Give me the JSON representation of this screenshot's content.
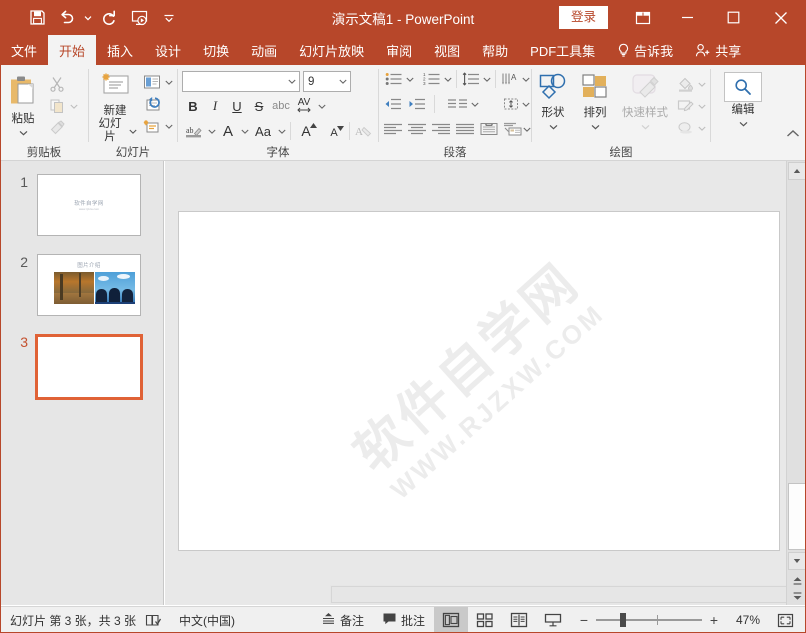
{
  "titlebar": {
    "document_title": "演示文稿1",
    "separator": "-",
    "app_name": "PowerPoint",
    "signin_label": "登录",
    "quick_access": [
      {
        "name": "save-icon",
        "label": "保存"
      },
      {
        "name": "undo-icon",
        "label": "撤消"
      },
      {
        "name": "redo-icon",
        "label": "恢复"
      },
      {
        "name": "start-slideshow-icon",
        "label": "从头开始"
      },
      {
        "name": "customize-quick-access-icon",
        "label": "自定义快速访问工具栏"
      }
    ],
    "window_buttons": [
      {
        "name": "ribbon-display-options-icon",
        "label": "功能区显示选项"
      },
      {
        "name": "minimize-icon",
        "label": "最小化"
      },
      {
        "name": "maximize-icon",
        "label": "最大化"
      },
      {
        "name": "close-icon",
        "label": "关闭"
      }
    ]
  },
  "tabs": [
    {
      "id": "file",
      "label": "文件",
      "active": false
    },
    {
      "id": "home",
      "label": "开始",
      "active": true
    },
    {
      "id": "insert",
      "label": "插入",
      "active": false
    },
    {
      "id": "design",
      "label": "设计",
      "active": false
    },
    {
      "id": "transitions",
      "label": "切换",
      "active": false
    },
    {
      "id": "animations",
      "label": "动画",
      "active": false
    },
    {
      "id": "slideshow",
      "label": "幻灯片放映",
      "active": false
    },
    {
      "id": "review",
      "label": "审阅",
      "active": false
    },
    {
      "id": "view",
      "label": "视图",
      "active": false
    },
    {
      "id": "help",
      "label": "帮助",
      "active": false
    },
    {
      "id": "pdf-toolkit",
      "label": "PDF工具集",
      "active": false
    }
  ],
  "tell_me": {
    "label": "告诉我",
    "icon": "lightbulb-icon"
  },
  "share": {
    "label": "共享",
    "icon": "person-add-icon"
  },
  "ribbon": {
    "clipboard": {
      "label": "剪贴板",
      "paste_label": "粘贴",
      "cut_label": "剪切",
      "copy_label": "复制",
      "format_painter_label": "格式刷"
    },
    "slides": {
      "label": "幻灯片",
      "new_slide_label": "新建\n幻灯片",
      "new_slide_line1": "新建",
      "new_slide_line2": "幻灯片",
      "layout_label": "版式",
      "reset_label": "重置",
      "section_label": "节"
    },
    "font": {
      "label": "字体",
      "font_name_value": "",
      "font_name_placeholder": "",
      "font_size_value": "9",
      "bold": "B",
      "italic": "I",
      "underline": "U",
      "strikethrough": "S",
      "shadow": "abc",
      "char_spacing": "AV",
      "text_highlight": "ab",
      "font_color": "A",
      "change_case": "Aa",
      "grow_font": "A",
      "shrink_font": "A",
      "clear_formatting": "清除所有格式"
    },
    "paragraph": {
      "label": "段落",
      "bullets": "项目符号",
      "numbering": "编号",
      "line_spacing": "行距",
      "text_direction": "文字方向",
      "decrease_indent": "减少缩进量",
      "increase_indent": "增加缩进量",
      "columns": "分栏",
      "align_text": "对齐文本",
      "align_left": "左对齐",
      "align_center": "居中",
      "align_right": "右对齐",
      "justify": "两端对齐",
      "convert_smartart": "转换为 SmartArt"
    },
    "drawing": {
      "label": "绘图",
      "shapes_label": "形状",
      "arrange_label": "排列",
      "quick_styles_label": "快速样式",
      "shape_fill": "形状填充",
      "shape_outline": "形状轮廓",
      "shape_effects": "形状效果"
    },
    "editing": {
      "label": "编辑",
      "edit_label": "编辑"
    },
    "collapse_ribbon": "折叠功能区"
  },
  "slides_panel": {
    "slides": [
      {
        "number": "1",
        "selected": false,
        "title": "软件自学网",
        "subtitle": "www.rjzxw.com",
        "kind": "title"
      },
      {
        "number": "2",
        "selected": false,
        "title": "图片介绍",
        "kind": "two-images"
      },
      {
        "number": "3",
        "selected": true,
        "title": "",
        "kind": "blank"
      }
    ]
  },
  "canvas": {
    "watermark_cn": "软件自学网",
    "watermark_en": "WWW.RJZXW.COM"
  },
  "statusbar": {
    "slide_count_text": "幻灯片 第 3 张，共 3 张",
    "spellcheck_icon": "proofing-icon",
    "language": "中文(中国)",
    "notes_label": "备注",
    "comments_label": "批注",
    "views": [
      {
        "id": "normal",
        "label": "普通视图",
        "icon": "normal-view-icon",
        "active": true
      },
      {
        "id": "sorter",
        "label": "幻灯片浏览",
        "icon": "slide-sorter-icon",
        "active": false
      },
      {
        "id": "reading",
        "label": "阅读视图",
        "icon": "reading-view-icon",
        "active": false
      },
      {
        "id": "slideshow",
        "label": "幻灯片放映",
        "icon": "slideshow-view-icon",
        "active": false
      }
    ],
    "zoom_out": "−",
    "zoom_in": "+",
    "zoom_value": "47%",
    "fit_window_label": "使幻灯片适应当前窗口"
  },
  "colors": {
    "accent": "#b7472a",
    "selection": "#e06236",
    "ribbon_bg": "#f3f3f3",
    "panel_bg": "#e6e6e6",
    "canvas_bg": "#e8e8e8"
  }
}
